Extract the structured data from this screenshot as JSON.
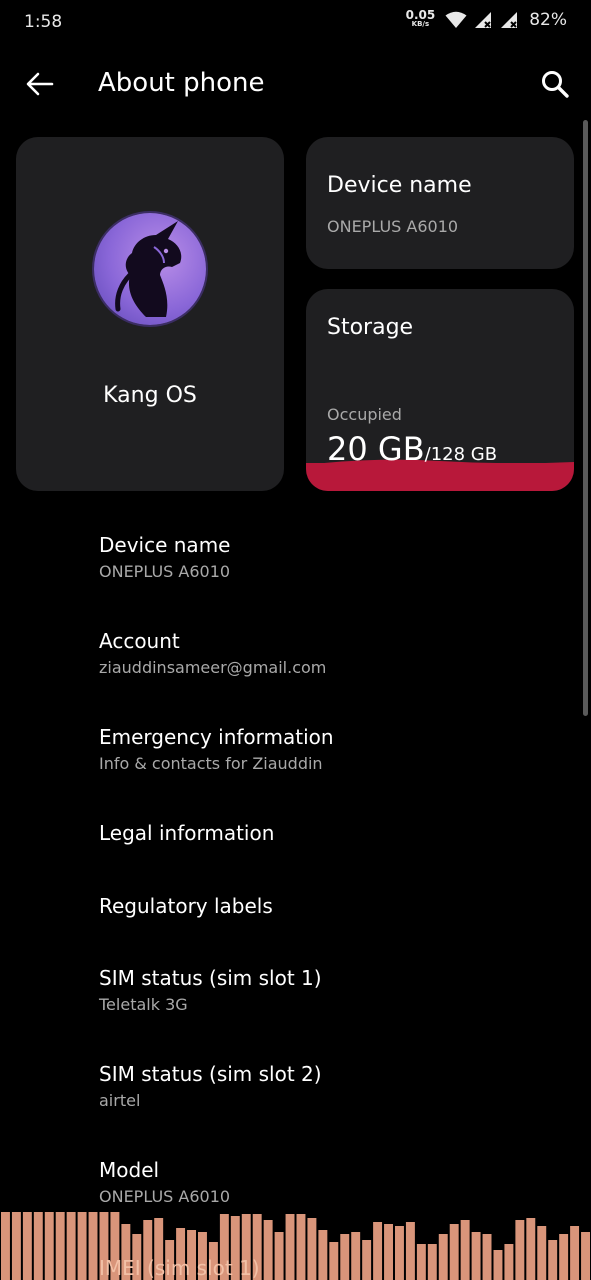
{
  "status_bar": {
    "time": "1:58",
    "net_speed": "0.05",
    "net_unit": "KB/s",
    "battery": "82%",
    "icons": [
      "wifi-icon",
      "signal-icon",
      "signal-icon",
      "battery-text"
    ]
  },
  "app_bar": {
    "title": "About phone",
    "back_icon": "arrow-left-icon",
    "search_icon": "search-icon"
  },
  "os_card": {
    "name": "Kang OS",
    "logo": "unicorn-logo"
  },
  "device_card": {
    "heading": "Device name",
    "value": "ONEPLUS A6010"
  },
  "storage_card": {
    "heading": "Storage",
    "occupied_label": "Occupied",
    "used": "20 GB",
    "total": "/128 GB",
    "fill_color": "#b8183a"
  },
  "items": [
    {
      "title": "Device name",
      "subtitle": "ONEPLUS A6010"
    },
    {
      "title": "Account",
      "subtitle": "ziauddinsameer@gmail.com"
    },
    {
      "title": "Emergency information",
      "subtitle": "Info & contacts for Ziauddin"
    },
    {
      "title": "Legal information",
      "subtitle": ""
    },
    {
      "title": "Regulatory labels",
      "subtitle": ""
    },
    {
      "title": "SIM status (sim slot 1)",
      "subtitle": "Teletalk 3G"
    },
    {
      "title": "SIM status (sim slot 2)",
      "subtitle": "airtel"
    },
    {
      "title": "Model",
      "subtitle": "ONEPLUS A6010"
    },
    {
      "title": "IMEI (sim slot 1)",
      "subtitle": ""
    }
  ],
  "overlay": {
    "equalizer_color": "#d9957a"
  }
}
